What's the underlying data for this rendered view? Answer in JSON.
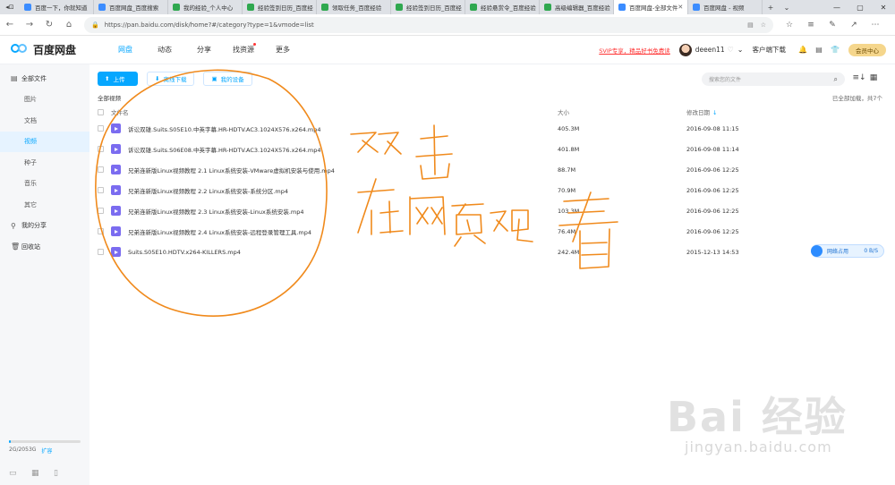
{
  "browser": {
    "tabs": [
      {
        "label": "百度一下，你就知道",
        "fav": "blue"
      },
      {
        "label": "百度网盘_百度搜索",
        "fav": "blue"
      },
      {
        "label": "我的经验_个人中心",
        "fav": "green"
      },
      {
        "label": "经验签到日历_百度经",
        "fav": "green"
      },
      {
        "label": "领取任务_百度经验",
        "fav": "green"
      },
      {
        "label": "经验签到日历_百度经",
        "fav": "green"
      },
      {
        "label": "经验悬赏令_百度经验",
        "fav": "green"
      },
      {
        "label": "高级编辑器_百度经验",
        "fav": "green"
      },
      {
        "label": "百度网盘-全部文件",
        "fav": "blue",
        "active": true
      },
      {
        "label": "百度网盘 - 视频",
        "fav": "blue"
      }
    ],
    "url": "https://pan.baidu.com/disk/home?#/category?type=1&vmode=list"
  },
  "header": {
    "brand": "百度网盘",
    "nav": [
      "网盘",
      "动态",
      "分享",
      "找资源",
      "更多"
    ],
    "svip_promo": "SVIP专享，精品好书免费读",
    "username": "deeen11",
    "client_download": "客户端下载",
    "member_center": "会员中心"
  },
  "sidebar": {
    "items": [
      {
        "label": "全部文件",
        "icon": "folder-icon",
        "sub": false
      },
      {
        "label": "图片",
        "sub": true
      },
      {
        "label": "文档",
        "sub": true
      },
      {
        "label": "视频",
        "sub": true,
        "active": true
      },
      {
        "label": "种子",
        "sub": true
      },
      {
        "label": "音乐",
        "sub": true
      },
      {
        "label": "其它",
        "sub": true
      },
      {
        "label": "我的分享",
        "icon": "share-icon",
        "sub": false
      },
      {
        "label": "回收站",
        "icon": "trash-icon",
        "sub": false
      }
    ],
    "quota_text": "2G/2053G",
    "quota_fraction": 0.001,
    "expand_label": "扩容"
  },
  "toolbar": {
    "upload": "上传",
    "offline_download": "离线下载",
    "my_devices": "我的设备",
    "search_placeholder": "搜索您的文件"
  },
  "content": {
    "breadcrumb": "全部视频",
    "loaded_text": "已全部加载，共7个",
    "columns": {
      "name": "文件名",
      "size": "大小",
      "modified": "修改日期"
    },
    "files": [
      {
        "name": "诉讼双雄.Suits.S05E10.中英字幕.HR-HDTV.AC3.1024X576.x264.mp4",
        "size": "405.3M",
        "modified": "2016-09-08 11:15"
      },
      {
        "name": "诉讼双雄.Suits.S06E08.中英字幕.HR-HDTV.AC3.1024X576.x264.mp4",
        "size": "401.8M",
        "modified": "2016-09-08 11:14"
      },
      {
        "name": "兄弟连新版Linux视频教程 2.1 Linux系统安装-VMware虚拟机安装与使用.mp4",
        "size": "88.7M",
        "modified": "2016-09-06 12:25"
      },
      {
        "name": "兄弟连新版Linux视频教程 2.2 Linux系统安装-系统分区.mp4",
        "size": "70.9M",
        "modified": "2016-09-06 12:25"
      },
      {
        "name": "兄弟连新版Linux视频教程 2.3 Linux系统安装-Linux系统安装.mp4",
        "size": "103.3M",
        "modified": "2016-09-06 12:25"
      },
      {
        "name": "兄弟连新版Linux视频教程 2.4 Linux系统安装-远程登录管理工具.mp4",
        "size": "76.4M",
        "modified": "2016-09-06 12:25"
      },
      {
        "name": "Suits.S05E10.HDTV.x264-KILLERS.mp4",
        "size": "242.4M",
        "modified": "2015-12-13 14:53"
      }
    ]
  },
  "network_widget": {
    "label": "网络占用",
    "speed": "0 B/S"
  },
  "annotation": {
    "line1": "双击",
    "line2": "在网页观看"
  },
  "watermark": {
    "big": "Bai 经验",
    "small": "jingyan.baidu.com"
  },
  "colors": {
    "accent": "#06a7ff",
    "ink": "#f08a1c",
    "file_icon": "#7b6cf0"
  }
}
